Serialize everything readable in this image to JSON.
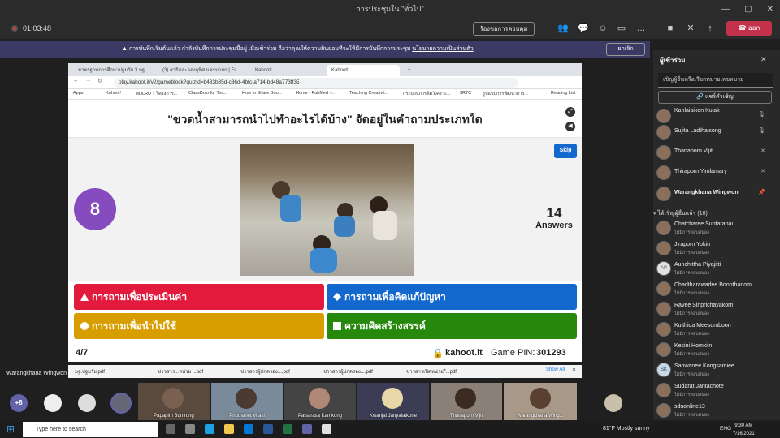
{
  "window": {
    "title": "การประชุมใน \"ทั่วไป\""
  },
  "meeting": {
    "timer": "01:03:48",
    "request_control": "ร้องขอการควบคุม",
    "leave": "ออก"
  },
  "banner": {
    "text": "การบันทึกเริ่มต้นแล้ว  กำลังบันทึกการประชุมนี้อยู่ เมื่อเข้าร่วม ถือว่าคุณให้ความยินยอมที่จะให้มีการบันทึกการประชุม",
    "link": "นโยบายความเป็นส่วนตัว",
    "dismiss": "ยกเลิก"
  },
  "browser": {
    "tabs": [
      "มาตรฐานการศึกษาปฐมวัย 3 มฐ.",
      "(3) สาธิตละอองอุทิศ นครนายก | Fa",
      "Kahoot!",
      "Kahoot!"
    ],
    "url": "play.kahoot.it/v2/gameblock?quizId=b483b85d-c86d-4bfc-a714-bd48a773ff35",
    "bookmarks": [
      "Apps",
      "Kahoot!",
      "eDLRU :: โครงการ...",
      "ClassDojo for Tea...",
      "How to Share Boo...",
      "Home - PubMed -...",
      "Teaching Creativit...",
      "กระบวนการคิดวิเคราะ...",
      "3R7C",
      "รูปแบบการพัฒนาการ...",
      "Reading List"
    ]
  },
  "kahoot": {
    "question": "\"ขวดน้ำสามารถนำไปทำอะไรได้บ้าง\" จัดอยู่ในคำถามประเภทใด",
    "timer": "8",
    "skip": "Skip",
    "answers_count": "14",
    "answers_label": "Answers",
    "options": [
      {
        "label": "การถามเพื่อประเมินค่า",
        "color": "#e21b3c",
        "shape": "triangle"
      },
      {
        "label": "การถามเพื่อคิดแก้ปัญหา",
        "color": "#1368ce",
        "shape": "diamond"
      },
      {
        "label": "การถามเพื่อนำไปใช้",
        "color": "#d89e00",
        "shape": "circle"
      },
      {
        "label": "ความคิดสร้างสรรค์",
        "color": "#26890c",
        "shape": "square"
      }
    ],
    "progress": "4/7",
    "brand": "kahoot.it",
    "pin_label": "Game PIN:",
    "pin": "301293"
  },
  "panel": {
    "title": "ผู้เข้าร่วม",
    "search_placeholder": "เชิญผู้อื่นหรือเรียกหมายเลขหมาย",
    "share": "แชร์คำเชิญ",
    "in_meeting": [
      {
        "name": "Kanlaiaikon Kulak",
        "icon": "mic-icon"
      },
      {
        "name": "Sujita Ladthaisong",
        "icon": "mic-icon"
      },
      {
        "name": "Thanaporn Vijit",
        "icon": "mic-off-icon"
      },
      {
        "name": "Thiraporn Yimlamary",
        "icon": "mic-off-icon"
      },
      {
        "name": "Warangkhana Wingwon",
        "icon": "pin-icon"
      }
    ],
    "not_joined_header": "ได้เชิญผู้อื่นแล้ว (10)",
    "not_joined": [
      {
        "name": "Chatcharee Suntarapai",
        "status": "ไม่มีการตอบสนอง"
      },
      {
        "name": "Jiraporn Yokin",
        "status": "ไม่มีการตอบสนอง"
      },
      {
        "name": "Aunchittha Piyajitti",
        "status": "ไม่มีการตอบสนอง",
        "initials": "AP"
      },
      {
        "name": "Chadtharawadee Boonthanom",
        "status": "ไม่มีการตอบสนอง"
      },
      {
        "name": "Ravee Siriprichayakorn",
        "status": "ไม่มีการตอบสนอง"
      },
      {
        "name": "Kulthida Meesomboon",
        "status": "ไม่มีการตอบสนอง"
      },
      {
        "name": "Kesini Homkiln",
        "status": "ไม่มีการตอบสนอง"
      },
      {
        "name": "Saowanee Kongsamiee",
        "status": "ไม่มีการตอบสนอง",
        "initials": "SK"
      },
      {
        "name": "Sudarat Jantachote",
        "status": "ไม่มีการตอบสนอง"
      },
      {
        "name": "sduonline13",
        "status": "ไม่มีการตอบสนอง"
      }
    ]
  },
  "downloads": {
    "files": [
      "มฐ.ปฐมวัย.pdf",
      "ข่าวสาร...หน่วย ...pdf",
      "ข่าวสารผู้ปกครอง....pdf",
      "ข่าวสารผู้ปกครอง....pdf",
      "ข่าวสารเปิดหน่วย 'ี...pdf"
    ],
    "show_all": "Show All"
  },
  "presenter": "Warangkhana Wingwon",
  "videos": {
    "more": "+8",
    "tiles": [
      "Papapim Bumrung",
      "Phuthanet Vitaki",
      "Patsarasa Kamkong",
      "Kwanjai Janyalatkone",
      "Thanaporn Vijit",
      "Warangkhana Wing..."
    ]
  },
  "taskbar": {
    "search": "Type here to search",
    "weather": "81°F  Mostly sunny",
    "lang": "ENG",
    "time": "9:30 AM",
    "date": "7/16/2021"
  }
}
